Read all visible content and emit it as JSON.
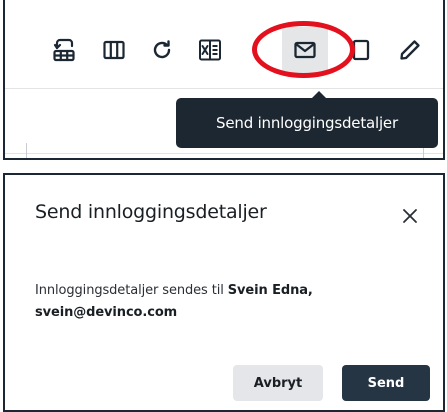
{
  "toolbar": {
    "buttons": [
      {
        "icon": "table-restore-icon"
      },
      {
        "icon": "columns-icon"
      },
      {
        "icon": "refresh-icon"
      },
      {
        "icon": "excel-export-icon"
      },
      {
        "icon": "mail-icon",
        "active": true
      },
      {
        "icon": "copy-icon"
      },
      {
        "icon": "pencil-icon"
      }
    ],
    "tooltip": "Send innloggingsdetaljer",
    "highlight_color": "#e3101e"
  },
  "dialog": {
    "title": "Send innloggingsdetaljer",
    "body_prefix": "Innloggingsdetaljer sendes til ",
    "recipient_name": "Svein Edna",
    "recipient_separator": ",",
    "recipient_email": "svein@devinco.com",
    "cancel_label": "Avbryt",
    "send_label": "Send",
    "primary_color": "#253544",
    "secondary_color": "#e4e6e9"
  }
}
